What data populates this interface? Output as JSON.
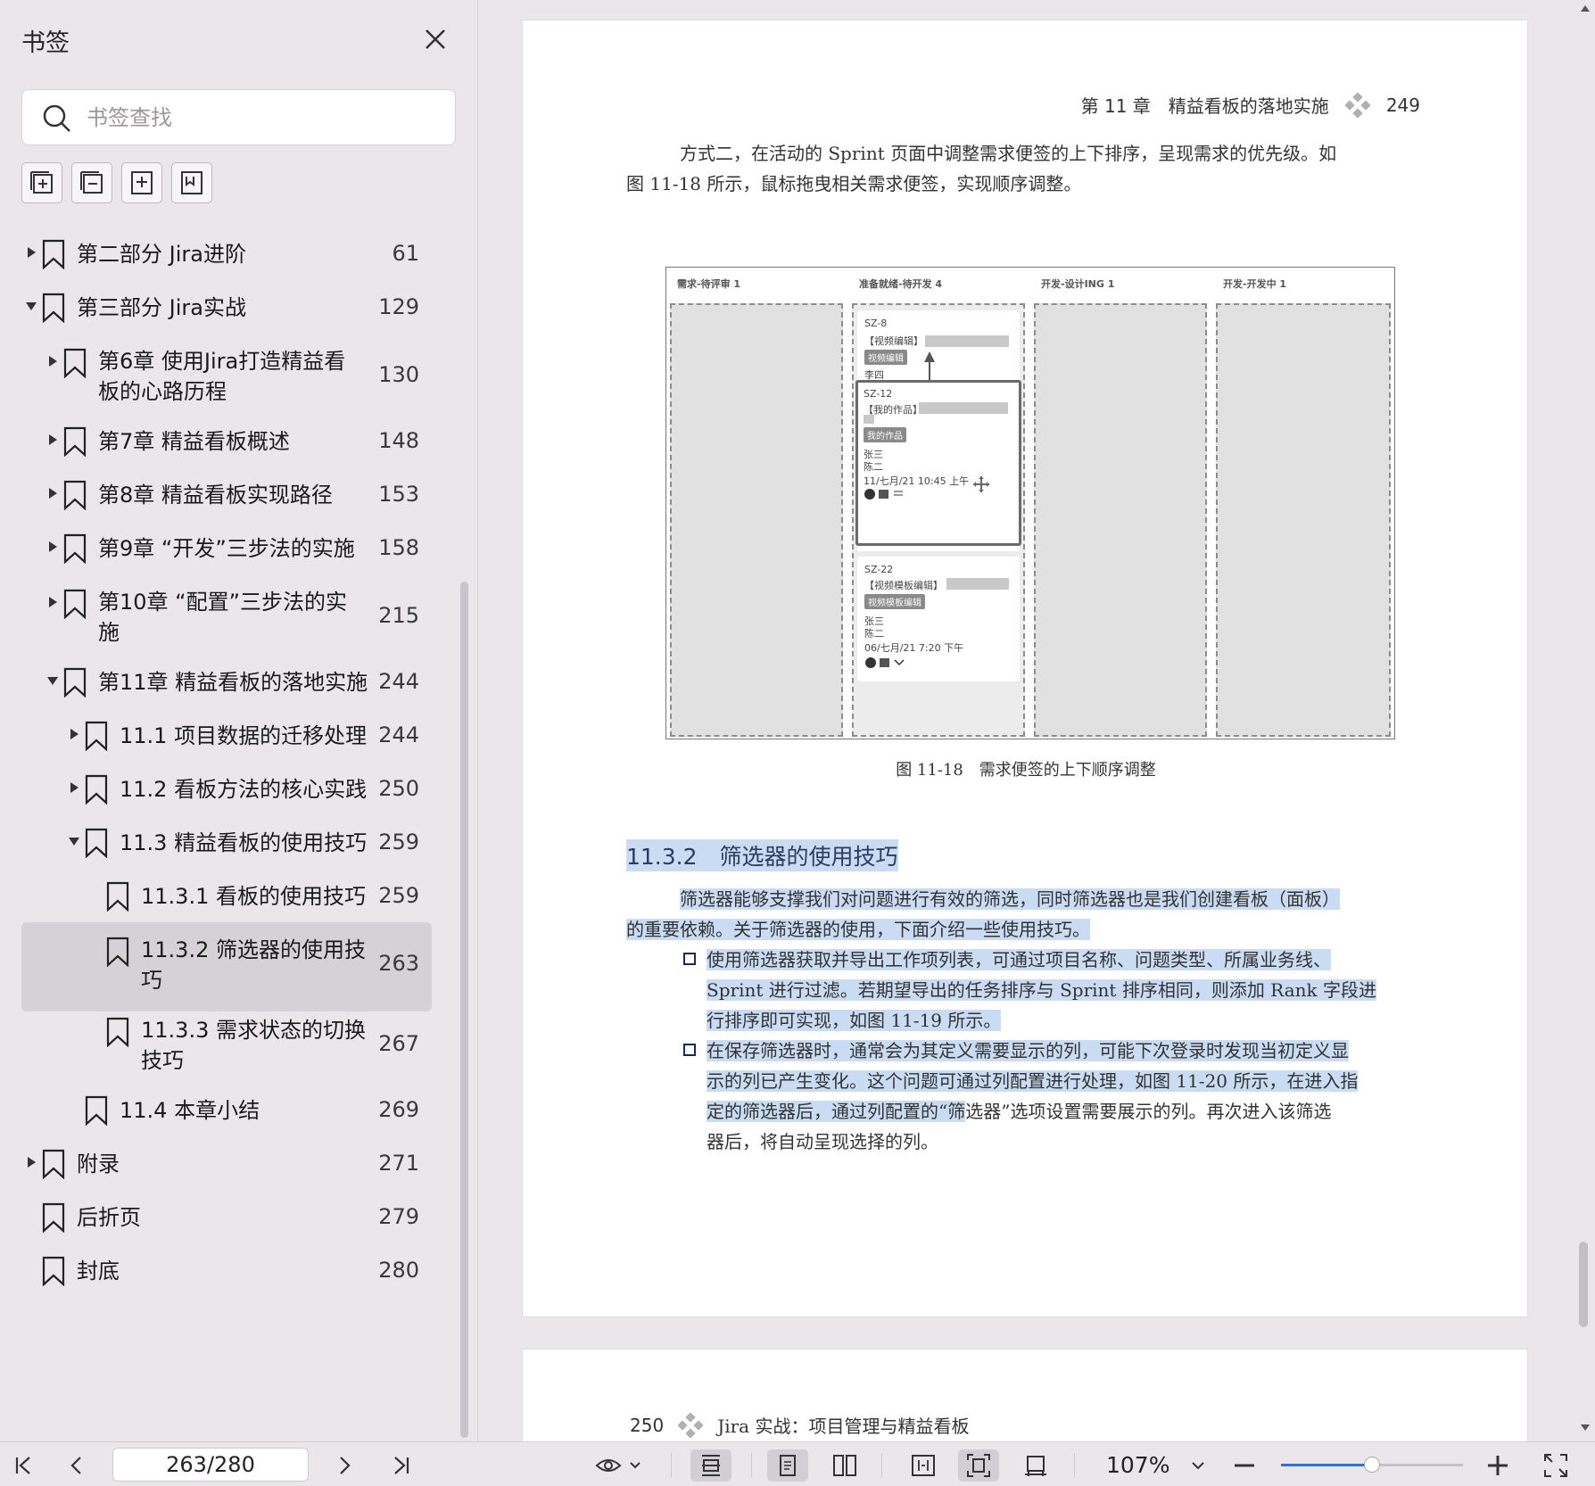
{
  "sidebar": {
    "title": "书签",
    "search_placeholder": "书签查找",
    "bookmarks": [
      {
        "label": "第二部分 Jira进阶",
        "page": "61",
        "level": 0,
        "arrow": "right"
      },
      {
        "label": "第三部分 Jira实战",
        "page": "129",
        "level": 0,
        "arrow": "down"
      },
      {
        "label": "第6章 使用Jira打造精益看",
        "label2": "板的心路历程",
        "page": "130",
        "level": 1,
        "arrow": "right"
      },
      {
        "label": "第7章 精益看板概述",
        "page": "148",
        "level": 1,
        "arrow": "right"
      },
      {
        "label": "第8章 精益看板实现路径",
        "page": "153",
        "level": 1,
        "arrow": "right"
      },
      {
        "label": "第9章 “开发”三步法的实施",
        "page": "158",
        "level": 1,
        "arrow": "right"
      },
      {
        "label": "第10章 “配置”三步法的实",
        "label2": "施",
        "page": "215",
        "level": 1,
        "arrow": "right"
      },
      {
        "label": "第11章 精益看板的落地实施",
        "page": "244",
        "level": 1,
        "arrow": "down"
      },
      {
        "label": "11.1 项目数据的迁移处理",
        "page": "244",
        "level": 2,
        "arrow": "right"
      },
      {
        "label": "11.2 看板方法的核心实践",
        "page": "250",
        "level": 2,
        "arrow": "right"
      },
      {
        "label": "11.3 精益看板的使用技巧",
        "page": "259",
        "level": 2,
        "arrow": "down"
      },
      {
        "label": "11.3.1 看板的使用技巧",
        "page": "259",
        "level": 3,
        "arrow": "none"
      },
      {
        "label": "11.3.2 筛选器的使用技",
        "label2": "巧",
        "page": "263",
        "level": 3,
        "arrow": "none",
        "selected": true
      },
      {
        "label": "11.3.3 需求状态的切换",
        "label2": "技巧",
        "page": "267",
        "level": 3,
        "arrow": "none"
      },
      {
        "label": "11.4 本章小结",
        "page": "269",
        "level": 2,
        "arrow": "none"
      },
      {
        "label": "附录",
        "page": "271",
        "level": 0,
        "arrow": "right"
      },
      {
        "label": "后折页",
        "page": "279",
        "level": 0,
        "arrow": "none"
      },
      {
        "label": "封底",
        "page": "280",
        "level": 0,
        "arrow": "none"
      }
    ]
  },
  "page1": {
    "running_head": "第 11 章　精益看板的落地实施",
    "page_number": "249",
    "intro_line1": "方式二，在活动的 Sprint 页面中调整需求便签的上下排序，呈现需求的优先级。如",
    "intro_line2": "图 11-18 所示，鼠标拖曳相关需求便签，实现顺序调整。",
    "figure": {
      "columns": [
        "需求-待评审 1",
        "准备就绪-待开发 4",
        "开发-设计ING 1",
        "开发-开发中 1"
      ],
      "card1": {
        "id": "SZ-8",
        "title": "【视频编辑】",
        "tag": "视频编辑",
        "person": "李四"
      },
      "card2": {
        "id": "SZ-12",
        "title": "【我的作品】",
        "tag": "我的作品",
        "person1": "张三",
        "person2": "陈二",
        "date": "11/七月/21 10:45 上午"
      },
      "card3": {
        "id": "SZ-22",
        "title": "【视频模板编辑】",
        "tag": "视频模板编辑",
        "person1": "张三",
        "person2": "陈二",
        "date": "06/七月/21 7:20 下午"
      }
    },
    "figure_caption": "图 11-18　需求便签的上下顺序调整",
    "section_title": "11.3.2　筛选器的使用技巧",
    "p1_line1": "筛选器能够支撑我们对问题进行有效的筛选，同时筛选器也是我们创建看板（面板）",
    "p1_line2": "的重要依赖。关于筛选器的使用，下面介绍一些使用技巧。",
    "b1_line1": "使用筛选器获取并导出工作项列表，可通过项目名称、问题类型、所属业务线、",
    "b1_line2": "Sprint 进行过滤。若期望导出的任务排序与 Sprint 排序相同，则添加 Rank 字段进",
    "b1_line3": "行排序即可实现，如图 11-19 所示。",
    "b2_line1": "在保存筛选器时，通常会为其定义需要显示的列，可能下次登录时发现当初定义显",
    "b2_line2": "示的列已产生变化。这个问题可通过列配置进行处理，如图 11-20 所示，在进入指",
    "b2_line3a": "定的筛选器后，通过列配置的“筛",
    "b2_line3b": "选器”选项设置需要展示的列。再次进入该筛选",
    "b2_line4": "器后，将自动呈现选择的列。"
  },
  "page2": {
    "page_number": "250",
    "running_head": "Jira 实战：项目管理与精益看板"
  },
  "toolbar": {
    "page_indicator": "263/280",
    "zoom": "107%",
    "zoom_slider_fraction": 0.5
  },
  "colors": {
    "highlight": "#c9dcf3",
    "section_title": "#2b3b63",
    "accent": "#2f6fd6"
  }
}
